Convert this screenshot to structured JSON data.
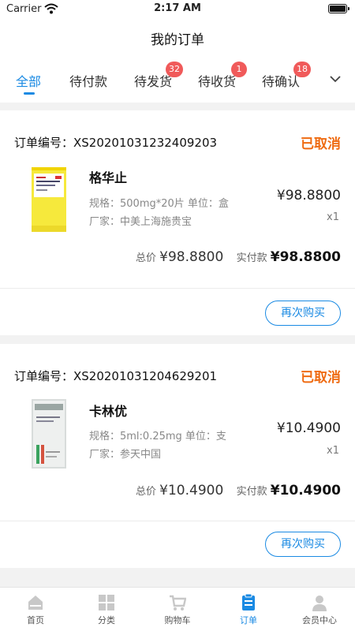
{
  "status_bar": {
    "carrier": "Carrier",
    "time": "2:17 AM"
  },
  "nav": {
    "title": "我的订单"
  },
  "tabs": [
    {
      "label": "全部",
      "badge": ""
    },
    {
      "label": "待付款",
      "badge": ""
    },
    {
      "label": "待发货",
      "badge": "32"
    },
    {
      "label": "待收货",
      "badge": "1"
    },
    {
      "label": "待确认",
      "badge": "18"
    }
  ],
  "orders": [
    {
      "order_no": "订单编号：XS20201031232409203",
      "status": "已取消",
      "product_name": "格华止",
      "spec": "规格：500mg*20片  单位：盒",
      "maker": "厂家：中美上海施贵宝",
      "price": "¥98.8800",
      "qty": "x1",
      "total_label": "总价",
      "total": "¥98.8800",
      "paid_label": "实付款",
      "paid": "¥98.8800",
      "rebuy": "再次购买"
    },
    {
      "order_no": "订单编号：XS20201031204629201",
      "status": "已取消",
      "product_name": "卡林优",
      "spec": "规格：5ml:0.25mg  单位：支",
      "maker": "厂家：参天中国",
      "price": "¥10.4900",
      "qty": "x1",
      "total_label": "总价",
      "total": "¥10.4900",
      "paid_label": "实付款",
      "paid": "¥10.4900",
      "rebuy": "再次购买"
    }
  ],
  "tab_bar": [
    {
      "label": "首页",
      "icon": "home-icon"
    },
    {
      "label": "分类",
      "icon": "category-icon"
    },
    {
      "label": "购物车",
      "icon": "cart-icon"
    },
    {
      "label": "订单",
      "icon": "orders-icon"
    },
    {
      "label": "会员中心",
      "icon": "member-icon"
    }
  ],
  "colors": {
    "accent": "#1a8ae3",
    "status_cancelled": "#ef6b12",
    "badge": "#f05a5a"
  }
}
